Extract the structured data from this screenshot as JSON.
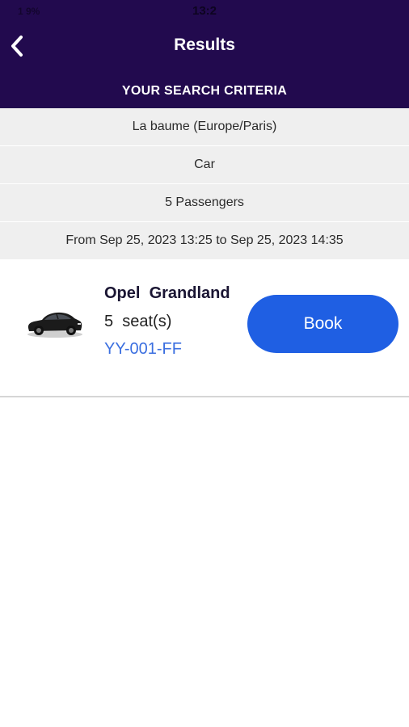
{
  "status_bar": {
    "time": "13:2",
    "left_text": "1   9%"
  },
  "header": {
    "title": "Results",
    "criteria_title": "YOUR SEARCH CRITERIA"
  },
  "criteria": [
    {
      "label": "La baume (Europe/Paris)"
    },
    {
      "label": "Car"
    },
    {
      "label": "5  Passengers"
    },
    {
      "label": "From Sep 25, 2023 13:25  to Sep 25, 2023 14:35"
    }
  ],
  "result": {
    "name": "Opel  Grandland",
    "seats": "5  seat(s)",
    "plate": "YY-001-FF",
    "book_label": "Book",
    "plate_color": "#3b6fe0"
  },
  "icons": {
    "back": "chevron-left-icon",
    "car": "car-image"
  },
  "colors": {
    "header_bg": "#220a4e",
    "button_bg": "#1f5fe3",
    "row_bg": "#efefef"
  }
}
